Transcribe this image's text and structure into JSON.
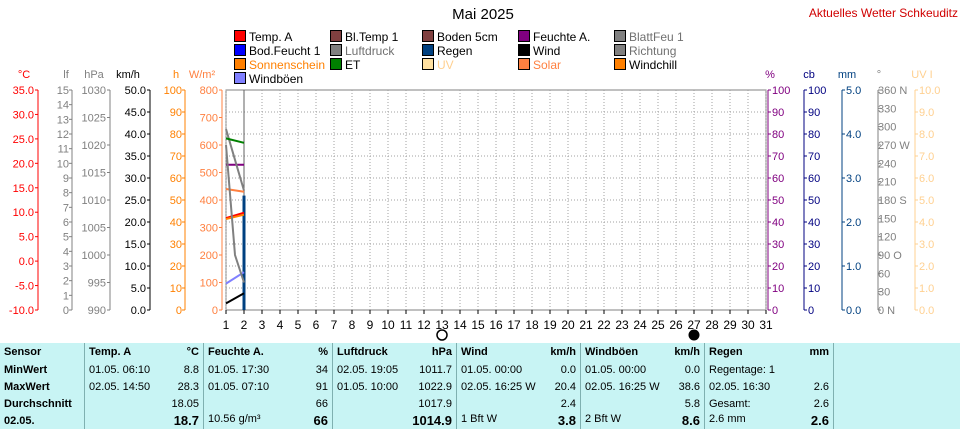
{
  "header": {
    "title": "Mai 2025",
    "link": "Aktuelles Wetter Schkeuditz"
  },
  "legend": [
    {
      "label": "Temp. A",
      "color": "#ff0000"
    },
    {
      "label": "Bl.Temp 1",
      "color": "#804040"
    },
    {
      "label": "Boden 5cm",
      "color": "#804040"
    },
    {
      "label": "Feuchte A.",
      "color": "#800080"
    },
    {
      "label": "BlattFeu 1",
      "color": "#808080",
      "muted": true
    },
    {
      "label": "Bod.Feucht 1",
      "color": "#0000ff"
    },
    {
      "label": "Luftdruck",
      "color": "#808080",
      "muted": true
    },
    {
      "label": "Regen",
      "color": "#004080"
    },
    {
      "label": "Wind",
      "color": "#000000"
    },
    {
      "label": "Richtung",
      "color": "#808080",
      "muted": true
    },
    {
      "label": "Sonnenschein",
      "color": "#ff8000",
      "text_color": "#ff8000"
    },
    {
      "label": "ET",
      "color": "#008000"
    },
    {
      "label": "UV",
      "color": "#ffe0a0",
      "text_color": "#ffd090"
    },
    {
      "label": "Solar",
      "color": "#ff8040",
      "text_color": "#ff8040"
    },
    {
      "label": "Windchill",
      "color": "#ff8000"
    },
    {
      "label": "Windböen",
      "color": "#8080ff"
    }
  ],
  "chart_data": {
    "type": "line",
    "title": "Mai 2025",
    "x": [
      1,
      2,
      3,
      4,
      5,
      6,
      7,
      8,
      9,
      10,
      11,
      12,
      13,
      14,
      15,
      16,
      17,
      18,
      19,
      20,
      21,
      22,
      23,
      24,
      25,
      26,
      27,
      28,
      29,
      30,
      31
    ],
    "xlim": [
      1,
      31
    ],
    "moon": {
      "new": 27,
      "full": 13
    },
    "axes": {
      "temp": {
        "unit": "°C",
        "ticks": [
          "35.0",
          "30.0",
          "25.0",
          "20.0",
          "15.0",
          "10.0",
          "5.0",
          "0.0",
          "-5.0",
          "-10.0"
        ],
        "range": [
          -10,
          35
        ],
        "color": "#ff0000"
      },
      "lf": {
        "unit": "lf",
        "ticks": [
          "15",
          "14",
          "13",
          "12",
          "11",
          "10",
          "9",
          "8",
          "7",
          "6",
          "5",
          "4",
          "3",
          "2",
          "1",
          "0"
        ],
        "range": [
          0,
          15
        ],
        "color": "#808080"
      },
      "hpa": {
        "unit": "hPa",
        "ticks": [
          "1030",
          "1025",
          "1020",
          "1015",
          "1010",
          "1005",
          "1000",
          "995",
          "990"
        ],
        "range": [
          990,
          1030
        ],
        "color": "#808080"
      },
      "kmh": {
        "unit": "km/h",
        "ticks": [
          "50.0",
          "45.0",
          "40.0",
          "35.0",
          "30.0",
          "25.0",
          "20.0",
          "15.0",
          "10.0",
          "5.0",
          "0.0"
        ],
        "range": [
          0,
          50
        ],
        "color": "#000000"
      },
      "h": {
        "unit": "h",
        "ticks": [
          "100",
          "90",
          "80",
          "70",
          "60",
          "50",
          "40",
          "30",
          "20",
          "10",
          "0"
        ],
        "range": [
          0,
          100
        ],
        "color": "#ff8000"
      },
      "wm2": {
        "unit": "W/m²",
        "ticks": [
          "800",
          "700",
          "600",
          "500",
          "400",
          "300",
          "200",
          "100",
          "0"
        ],
        "range": [
          0,
          800
        ],
        "color": "#ff8040"
      },
      "pct": {
        "unit": "%",
        "ticks": [
          "100",
          "90",
          "80",
          "70",
          "60",
          "50",
          "40",
          "30",
          "20",
          "10",
          "0"
        ],
        "range": [
          0,
          100
        ],
        "color": "#800080"
      },
      "cb": {
        "unit": "cb",
        "ticks": [
          "100",
          "90",
          "80",
          "70",
          "60",
          "50",
          "40",
          "30",
          "20",
          "10",
          "0"
        ],
        "range": [
          0,
          100
        ],
        "color": "#000080"
      },
      "mm": {
        "unit": "mm",
        "ticks": [
          "5.0",
          "4.0",
          "3.0",
          "2.0",
          "1.0",
          "0.0"
        ],
        "range": [
          0,
          5
        ],
        "color": "#004080"
      },
      "deg": {
        "unit": "°",
        "ticks": [
          "360 N",
          "330",
          "300",
          "270 W",
          "240",
          "210",
          "180 S",
          "150",
          "120",
          "90 O",
          "60",
          "30",
          "0 N"
        ],
        "range": [
          0,
          360
        ],
        "color": "#808080"
      },
      "uvi": {
        "unit": "UV I",
        "ticks": [
          "10.0",
          "9.0",
          "8.0",
          "7.0",
          "6.0",
          "5.0",
          "4.0",
          "3.0",
          "2.0",
          "1.0",
          "0.0"
        ],
        "range": [
          0,
          10
        ],
        "color": "#ffd090"
      }
    },
    "series": [
      {
        "name": "Temp. A",
        "axis": "temp",
        "color": "#ff0000",
        "x": [
          1,
          2
        ],
        "y": [
          8.8,
          9.9
        ]
      },
      {
        "name": "Feuchte A.",
        "axis": "pct",
        "color": "#800080",
        "x": [
          1,
          2
        ],
        "y": [
          66,
          66
        ]
      },
      {
        "name": "Luftdruck",
        "axis": "hpa",
        "color": "#808080",
        "x": [
          1,
          2
        ],
        "y": [
          1022.9,
          1011.7
        ]
      },
      {
        "name": "ET",
        "axis": "h",
        "color": "#008000",
        "x": [
          1,
          2
        ],
        "y": [
          78,
          76
        ]
      },
      {
        "name": "Windchill",
        "axis": "temp",
        "color": "#ff8000",
        "x": [
          1,
          2
        ],
        "y": [
          8.6,
          9.5
        ]
      },
      {
        "name": "Solar",
        "axis": "wm2",
        "color": "#ff8040",
        "x": [
          1,
          2
        ],
        "y": [
          440,
          430
        ]
      },
      {
        "name": "Wind",
        "axis": "kmh",
        "color": "#000000",
        "x": [
          1,
          2
        ],
        "y": [
          1.5,
          3.8
        ]
      },
      {
        "name": "Windböen",
        "axis": "kmh",
        "color": "#8080ff",
        "x": [
          1,
          2
        ],
        "y": [
          6,
          8.6
        ]
      },
      {
        "name": "Richtung",
        "axis": "deg",
        "color": "#808080",
        "x": [
          1,
          1.5,
          2
        ],
        "y": [
          270,
          90,
          45
        ]
      }
    ],
    "bars": [
      {
        "name": "Regen",
        "axis": "mm",
        "color": "#004080",
        "x": 2,
        "y": 2.6
      }
    ]
  },
  "stats": {
    "header": [
      {
        "left": "Sensor",
        "right": ""
      },
      {
        "left": "Temp. A",
        "right": "°C"
      },
      {
        "left": "Feuchte A.",
        "right": "%"
      },
      {
        "left": "Luftdruck",
        "right": "hPa"
      },
      {
        "left": "Wind",
        "right": "km/h"
      },
      {
        "left": "Windböen",
        "right": "km/h"
      },
      {
        "left": "Regen",
        "right": "mm"
      }
    ],
    "rows": [
      {
        "label": "MinWert",
        "cells": [
          [
            "01.05.  06:10",
            "8.8"
          ],
          [
            "01.05.  17:30",
            "34"
          ],
          [
            "02.05.  19:05",
            "1011.7"
          ],
          [
            "01.05.  00:00",
            "0.0"
          ],
          [
            "01.05.  00:00",
            "0.0"
          ],
          [
            "Regentage: 1",
            ""
          ]
        ]
      },
      {
        "label": "MaxWert",
        "cells": [
          [
            "02.05.  14:50",
            "28.3"
          ],
          [
            "01.05.  07:10",
            "91"
          ],
          [
            "01.05.  10:00",
            "1022.9"
          ],
          [
            "02.05.  16:25  W",
            "20.4"
          ],
          [
            "02.05.  16:25  W",
            "38.6"
          ],
          [
            "02.05.  16:30",
            "2.6"
          ]
        ]
      },
      {
        "label": "Durchschnitt",
        "cells": [
          [
            "",
            "18.05"
          ],
          [
            "",
            "66"
          ],
          [
            "",
            "1017.9"
          ],
          [
            "",
            "2.4"
          ],
          [
            "",
            "5.8"
          ],
          [
            "Gesamt:",
            "2.6"
          ]
        ]
      },
      {
        "label": "02.05.",
        "cells": [
          [
            "",
            "18.7"
          ],
          [
            "10.56 g/m³",
            "66"
          ],
          [
            "",
            "1014.9"
          ],
          [
            "1 Bft W",
            "3.8"
          ],
          [
            "2 Bft W",
            "8.6"
          ],
          [
            "2.6 mm",
            "2.6"
          ]
        ]
      }
    ]
  }
}
